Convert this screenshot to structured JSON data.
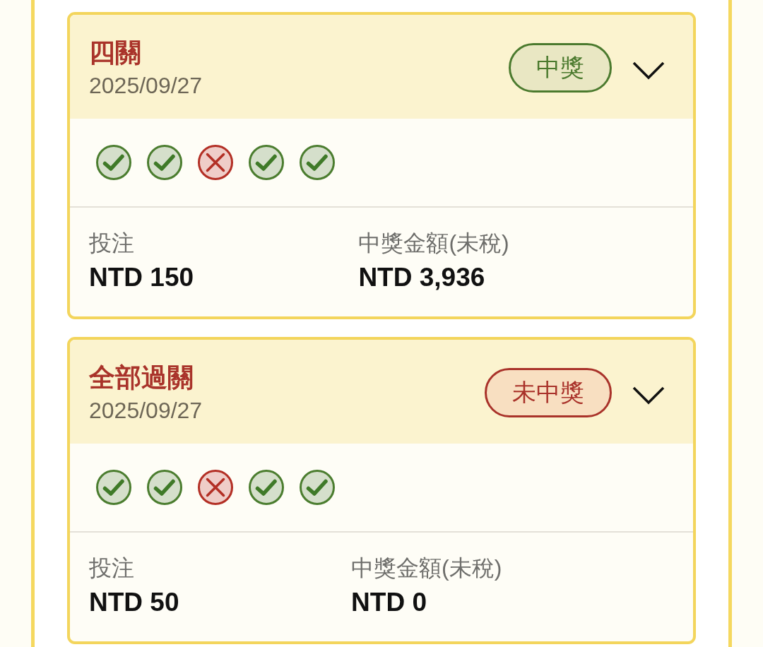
{
  "bets": [
    {
      "title": "四關",
      "date": "2025/09/27",
      "status": {
        "label": "中獎",
        "kind": "won"
      },
      "legs": [
        {
          "won": true
        },
        {
          "won": true
        },
        {
          "won": false
        },
        {
          "won": true
        },
        {
          "won": true
        }
      ],
      "stake": {
        "label": "投注",
        "value": "NTD 150"
      },
      "payout": {
        "label": "中獎金額(未稅)",
        "value": "NTD 3,936"
      }
    },
    {
      "title": "全部過關",
      "date": "2025/09/27",
      "status": {
        "label": "未中獎",
        "kind": "lost"
      },
      "legs": [
        {
          "won": true
        },
        {
          "won": true
        },
        {
          "won": false
        },
        {
          "won": true
        },
        {
          "won": true
        }
      ],
      "stake": {
        "label": "投注",
        "value": "NTD 50"
      },
      "payout": {
        "label": "中獎金額(未稅)",
        "value": "NTD 0"
      }
    }
  ]
}
